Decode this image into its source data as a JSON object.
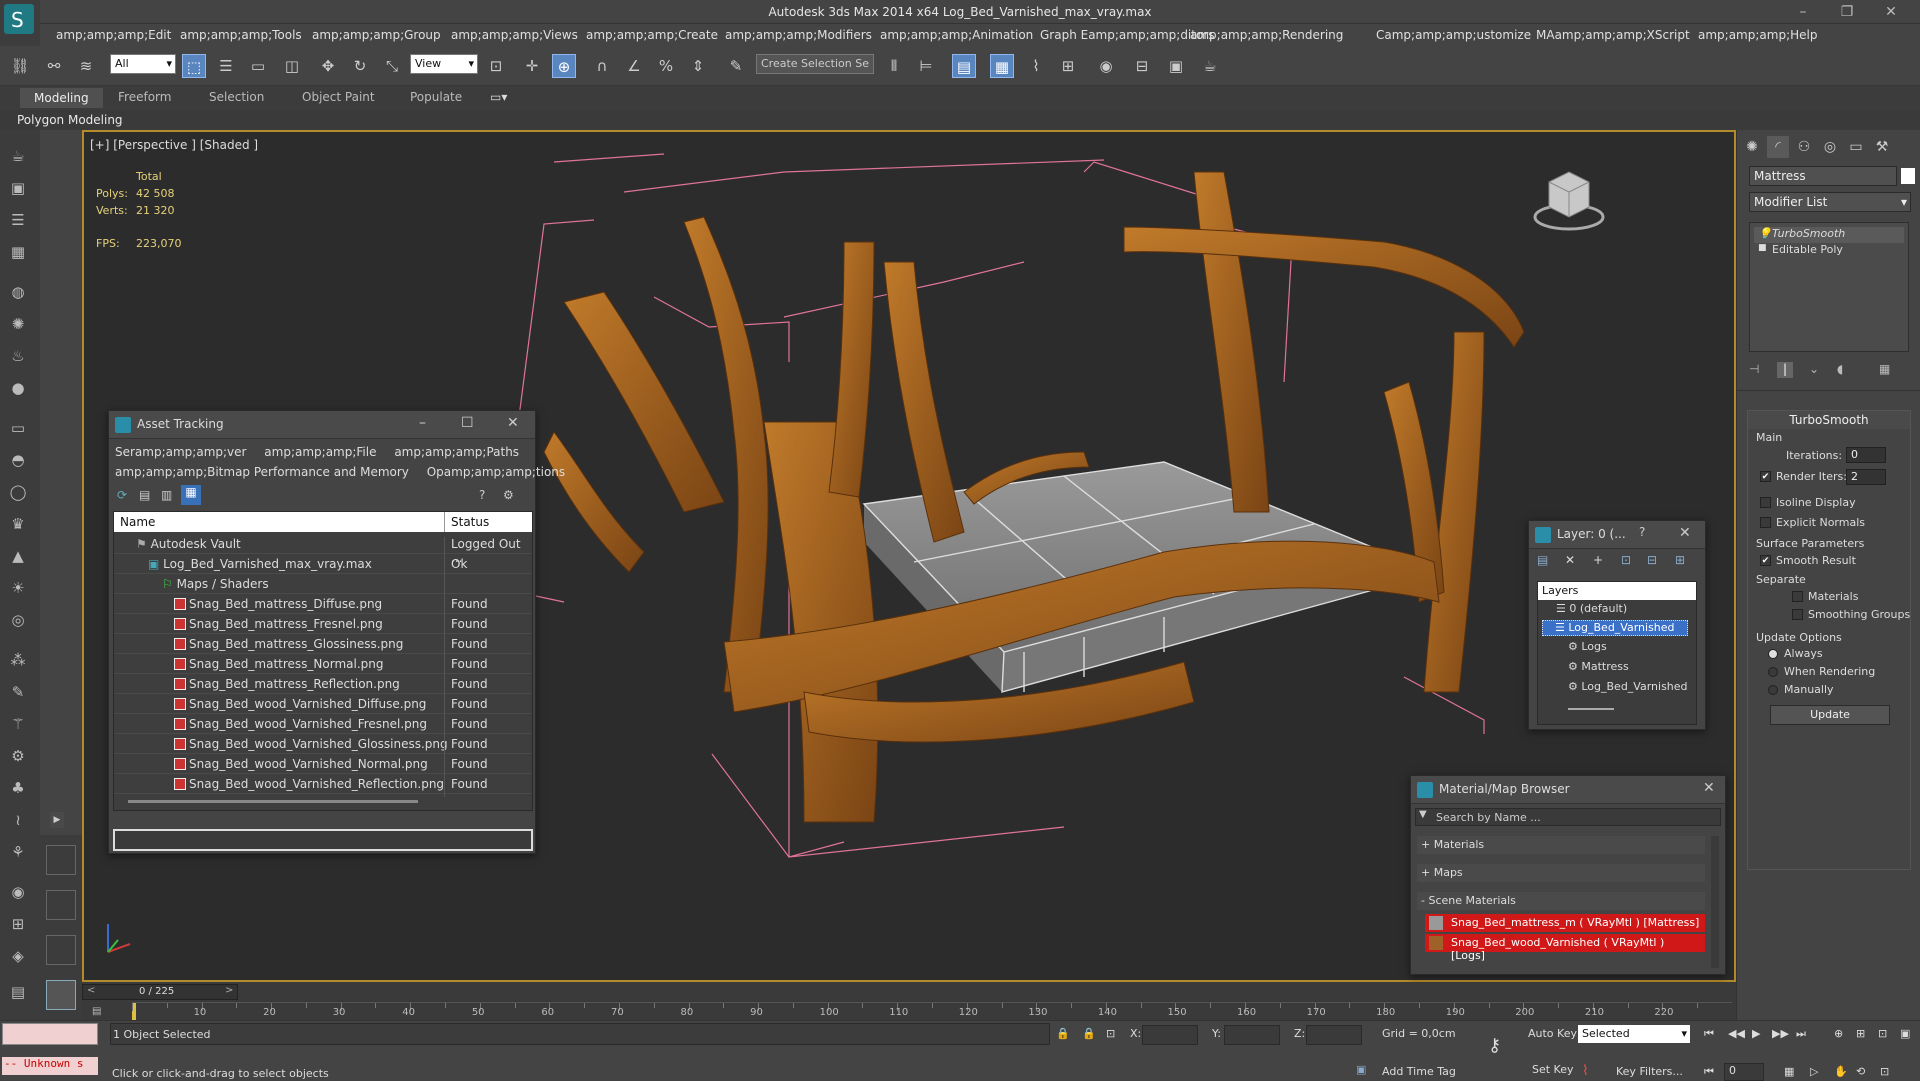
{
  "app": {
    "title": "Autodesk 3ds Max  2014 x64      Log_Bed_Varnished_max_vray.max",
    "win_minimize": "–",
    "win_restore": "❐",
    "win_close": "✕"
  },
  "menubar": [
    "amp;amp;amp;Edit",
    "amp;amp;amp;Tools",
    "amp;amp;amp;Group",
    "amp;amp;amp;Views",
    "amp;amp;amp;Create",
    "amp;amp;amp;Modifiers",
    "amp;amp;amp;Animation",
    "Graph Eamp;amp;amp;ditors",
    "amp;amp;amp;Rendering",
    "Camp;amp;amp;ustomize",
    "MAamp;amp;amp;XScript",
    "amp;amp;amp;Help"
  ],
  "toolbar": {
    "filter_value": "All",
    "refcoord_value": "View",
    "selection_set_placeholder": "Create Selection Se"
  },
  "ribbon": {
    "tabs": [
      "Modeling",
      "Freeform",
      "Selection",
      "Object Paint",
      "Populate"
    ],
    "subpanel": "Polygon Modeling"
  },
  "viewport": {
    "label": "[+] [Perspective ] [Shaded ]",
    "stats": {
      "total_label": "Total",
      "polys_label": "Polys:",
      "polys_value": "42 508",
      "verts_label": "Verts:",
      "verts_value": "21 320",
      "fps_label": "FPS:",
      "fps_value": "223,070"
    }
  },
  "asset_tracking": {
    "title": "Asset Tracking",
    "menu": [
      "Seramp;amp;amp;ver",
      "amp;amp;amp;File",
      "amp;amp;amp;Paths",
      "amp;amp;amp;Bitmap Performance and Memory",
      "Opamp;amp;amp;tions"
    ],
    "col_name": "Name",
    "col_status": "Status",
    "rows": [
      {
        "name": "Autodesk Vault",
        "status": "Logged Out ..."
      },
      {
        "name": "Log_Bed_Varnished_max_vray.max",
        "status": "Ok"
      },
      {
        "name": "Maps / Shaders",
        "status": ""
      },
      {
        "name": "Snag_Bed_mattress_Diffuse.png",
        "status": "Found"
      },
      {
        "name": "Snag_Bed_mattress_Fresnel.png",
        "status": "Found"
      },
      {
        "name": "Snag_Bed_mattress_Glossiness.png",
        "status": "Found"
      },
      {
        "name": "Snag_Bed_mattress_Normal.png",
        "status": "Found"
      },
      {
        "name": "Snag_Bed_mattress_Reflection.png",
        "status": "Found"
      },
      {
        "name": "Snag_Bed_wood_Varnished_Diffuse.png",
        "status": "Found"
      },
      {
        "name": "Snag_Bed_wood_Varnished_Fresnel.png",
        "status": "Found"
      },
      {
        "name": "Snag_Bed_wood_Varnished_Glossiness.png",
        "status": "Found"
      },
      {
        "name": "Snag_Bed_wood_Varnished_Normal.png",
        "status": "Found"
      },
      {
        "name": "Snag_Bed_wood_Varnished_Reflection.png",
        "status": "Found"
      }
    ]
  },
  "layers": {
    "title": "Layer: 0 (...",
    "help": "?",
    "header": "Layers",
    "items": [
      "0 (default)",
      "Log_Bed_Varnished",
      "Logs",
      "Mattress",
      "Log_Bed_Varnished"
    ]
  },
  "material_browser": {
    "title": "Material/Map Browser",
    "search_placeholder": "Search by Name ...",
    "groups": [
      "+ Materials",
      "+ Maps",
      "- Scene Materials"
    ],
    "materials": [
      "Snag_Bed_mattress_m  ( VRayMtl ) [Mattress]",
      "Snag_Bed_wood_Varnished  ( VRayMtl ) [Logs]"
    ]
  },
  "command_panel": {
    "object_name": "Mattress",
    "modifier_list": "Modifier List",
    "stack": [
      "TurboSmooth",
      "Editable Poly"
    ],
    "turbosmooth": {
      "title": "TurboSmooth",
      "main": "Main",
      "iterations_label": "Iterations:",
      "iterations_value": "0",
      "render_iters_label": "Render Iters:",
      "render_iters_value": "2",
      "isoline": "Isoline Display",
      "explicit_normals": "Explicit Normals",
      "surface_params": "Surface Parameters",
      "smooth_result": "Smooth Result",
      "separate": "Separate",
      "materials": "Materials",
      "smoothing_groups": "Smoothing Groups",
      "update_options": "Update Options",
      "always": "Always",
      "when_rendering": "When Rendering",
      "manually": "Manually",
      "update_button": "Update"
    }
  },
  "timeline": {
    "frame": "0 / 225",
    "ticks": [
      "10",
      "20",
      "30",
      "40",
      "50",
      "60",
      "70",
      "80",
      "90",
      "100",
      "110",
      "120",
      "130",
      "140",
      "150",
      "160",
      "170",
      "180",
      "190",
      "200",
      "210",
      "220"
    ]
  },
  "statusbar": {
    "maxscript": "-- Unknown s",
    "selected": "1 Object Selected",
    "prompt": "Click or click-and-drag to select objects",
    "x_label": "X:",
    "y_label": "Y:",
    "z_label": "Z:",
    "grid": "Grid = 0,0cm",
    "add_time_tag": "Add Time Tag",
    "auto_key": "Auto Key",
    "set_key": "Set Key",
    "selected_dropdown": "Selected",
    "key_filters": "Key Filters...",
    "frame_value": "0"
  }
}
